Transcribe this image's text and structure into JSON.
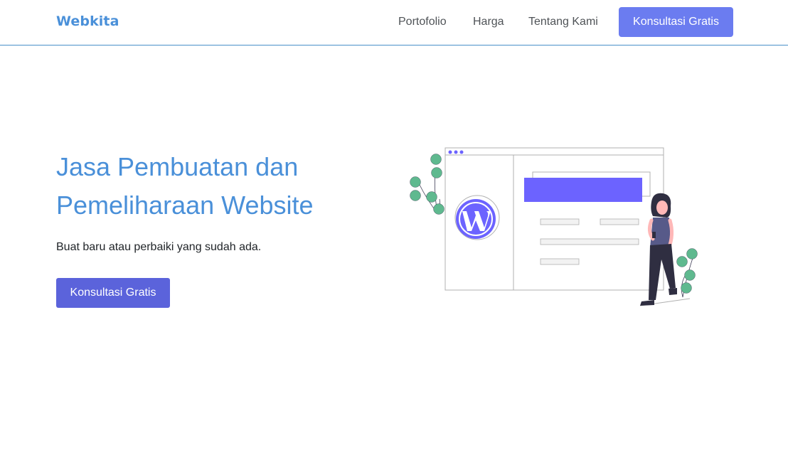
{
  "nav": {
    "brand": "Webkita",
    "links": [
      "Portofolio",
      "Harga",
      "Tentang Kami"
    ],
    "cta_label": "Konsultasi Gratis"
  },
  "hero": {
    "title_line1": "Jasa Pembuatan dan",
    "title_line2": "Pemeliharaan Website",
    "subtitle": "Buat baru atau perbaiki yang sudah ada.",
    "cta_label": "Konsultasi Gratis"
  },
  "colors": {
    "brand": "#4a90d9",
    "accent": "#6c63ff",
    "button": "#5b63db",
    "nav_button": "#6b7cf0",
    "plant": "#5fb98f"
  },
  "illustration": {
    "icons": [
      "wordpress-icon",
      "browser-window",
      "plant",
      "woman-with-phone"
    ]
  }
}
